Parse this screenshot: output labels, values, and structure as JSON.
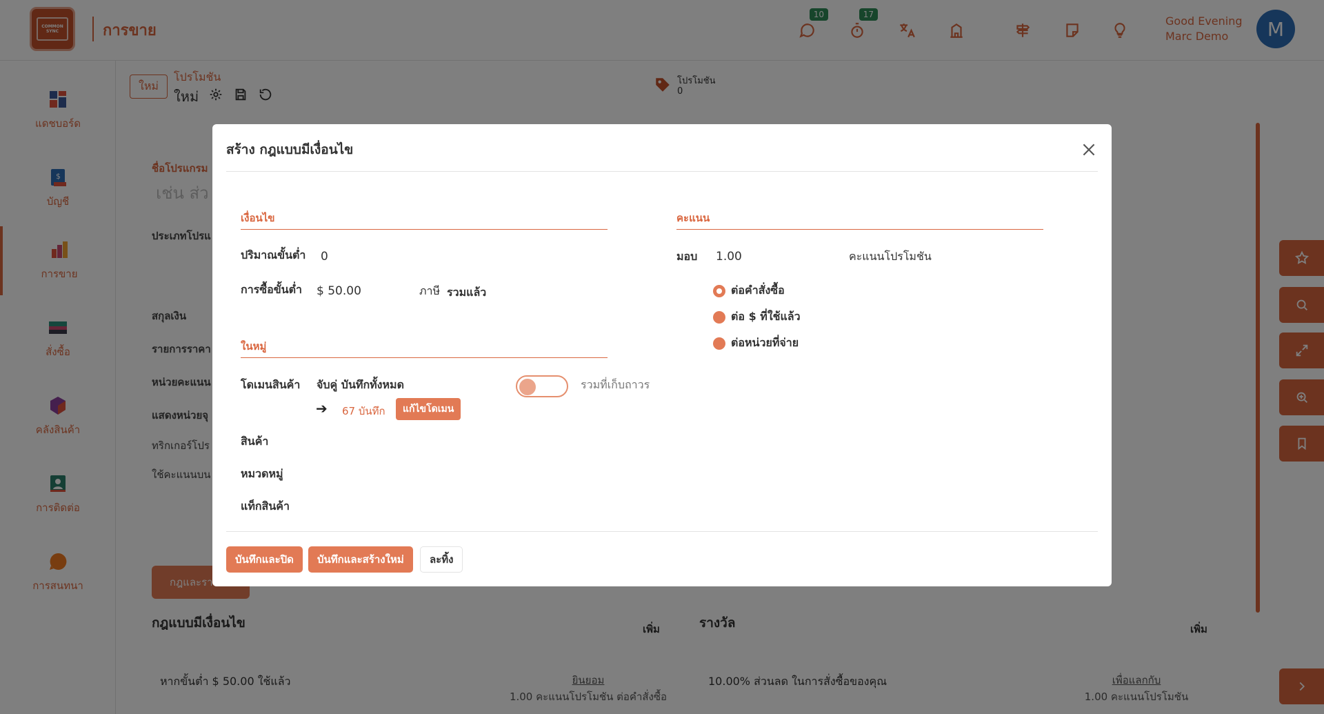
{
  "app": {
    "title": "การขาย",
    "logo_text": "COMMON SYNC"
  },
  "header": {
    "greeting": "Good Evening",
    "user_name": "Marc Demo",
    "avatar_letter": "M",
    "messages_badge": "10",
    "activity_badge": "17"
  },
  "sidebar": {
    "items": [
      {
        "label": "แดชบอร์ด",
        "icon": "dashboard-icon"
      },
      {
        "label": "บัญชี",
        "icon": "accounting-icon"
      },
      {
        "label": "การขาย",
        "icon": "sales-icon"
      },
      {
        "label": "สั่งซื้อ",
        "icon": "purchase-icon"
      },
      {
        "label": "คลังสินค้า",
        "icon": "inventory-icon"
      },
      {
        "label": "การติดต่อ",
        "icon": "contacts-icon"
      },
      {
        "label": "การสนทนา",
        "icon": "discuss-icon"
      }
    ]
  },
  "breadcrumb": {
    "new_badge": "ใหม่",
    "title": "โปรโมชัน",
    "sub": "ใหม่"
  },
  "promo_counter": {
    "label": "โปรโมชัน",
    "count": "0"
  },
  "bg_form": {
    "program_name_label": "ชื่อโปรแกรม",
    "program_name_placeholder": "เช่น ส่ว",
    "program_type_label": "ประเภทโปรแ",
    "currency_label": "สกุลเงิน",
    "pricelist_label": "รายการราคา",
    "points_unit_label": "หน่วยคะแนน",
    "display_label": "แสดงหน่วยจุ",
    "trigger_label": "ทริกเกอร์โปร",
    "use_points_label": "ใช้คะแนนบน",
    "rules_button": "กฎและรา"
  },
  "bg_sections": {
    "rules_title": "กฎแบบมีเงื่อนไข",
    "rules_add": "เพิ่ม",
    "rewards_title": "รางวัล",
    "rewards_add": "เพิ่ม",
    "rule_row_text": "หากขั้นต่ำ $ 50.00 ใช้แล้ว",
    "rule_row_action": "ยินยอม",
    "rule_row_action_sub": "1.00 คะแนนโปรโมชัน ต่อคำสั่งซื้อ",
    "reward_row_text": "10.00% ส่วนลด ในการสั่งซื้อของคุณ",
    "reward_row_action": "เพื่อแลกกับ",
    "reward_row_action_sub": "1.00 คะแนนโปรโมชัน"
  },
  "modal": {
    "title": "สร้าง กฎแบบมีเงื่อนไข",
    "conditions": {
      "heading": "เงื่อนไข",
      "min_qty_label": "ปริมาณขั้นต่ำ",
      "min_qty_value": "0",
      "min_purchase_label": "การซื้อขั้นต่ำ",
      "min_purchase_value": "$ 50.00",
      "tax_label": "ภาษี",
      "tax_value": "รวมแล้ว"
    },
    "among": {
      "heading": "ในหมู่",
      "domain_label": "โดเมนสินค้า",
      "domain_value": "จับคู่ บันทึกทั้งหมด",
      "archived_label": "รวมที่เก็บถาวร",
      "archived_on": false,
      "records_link": "67 บันทึก",
      "edit_domain_button": "แก้ไขโดเมน",
      "products_label": "สินค้า",
      "category_label": "หมวดหมู่",
      "tags_label": "แท็กสินค้า"
    },
    "points": {
      "heading": "คะแนน",
      "grant_label": "มอบ",
      "grant_value": "1.00",
      "unit_label": "คะแนนโปรโมชัน",
      "options": [
        {
          "label": "ต่อคำสั่งซื้อ",
          "checked": true
        },
        {
          "label": "ต่อ $ ที่ใช้แล้ว",
          "checked": false
        },
        {
          "label": "ต่อหน่วยที่จ่าย",
          "checked": false
        }
      ]
    },
    "buttons": {
      "save_close": "บันทึกและปิด",
      "save_new": "บันทึกและสร้างใหม่",
      "discard": "ละทิ้ง"
    }
  },
  "colors": {
    "accent": "#d9663f",
    "accent_light": "#e27a55",
    "badge": "#2e8b57",
    "avatar": "#2d6db5"
  }
}
